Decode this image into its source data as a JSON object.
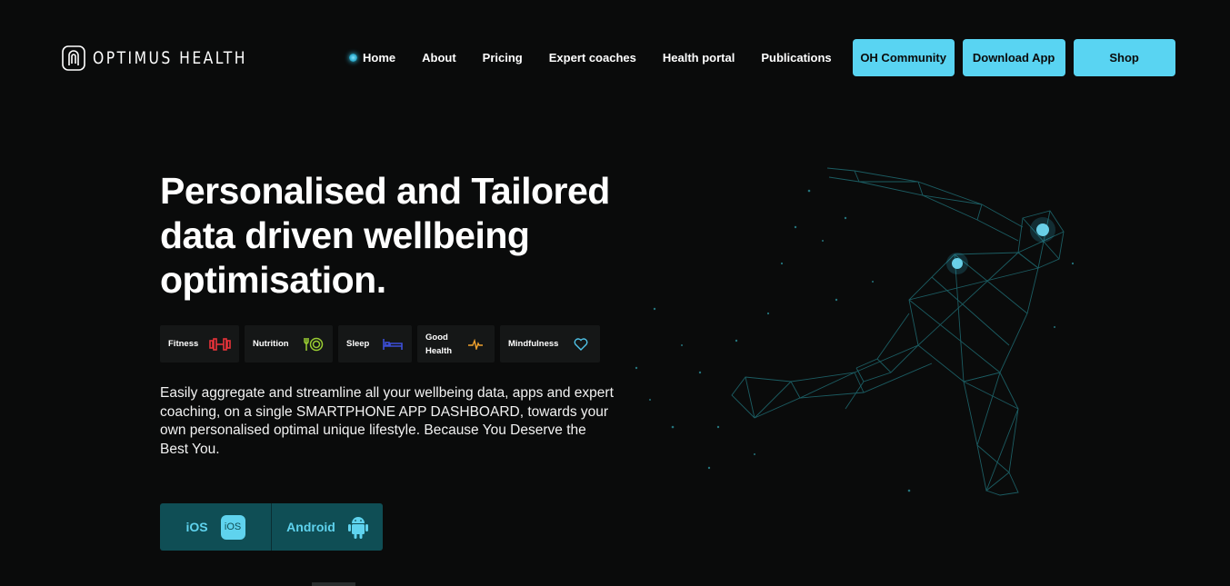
{
  "brand": {
    "name": "OPTIMUS HEALTH",
    "logo_icon": "fingerprint-icon"
  },
  "nav": {
    "links": [
      "Home",
      "About",
      "Pricing",
      "Expert coaches",
      "Health portal",
      "Publications"
    ],
    "buttons": [
      "OH Community",
      "Download App",
      "Shop"
    ],
    "accent": "#59d4f2"
  },
  "hero": {
    "title": "Personalised and Tailored data driven wellbeing optimisation.",
    "categories": [
      {
        "label": "Fitness",
        "icon": "dumbbell-icon",
        "color": "#e8333a"
      },
      {
        "label": "Nutrition",
        "icon": "plate-cutlery-icon",
        "color": "#9acd32"
      },
      {
        "label": "Sleep",
        "icon": "bed-icon",
        "color": "#3d4fd9"
      },
      {
        "label": "Good Health",
        "icon": "heartbeat-icon",
        "color": "#f0a22e"
      },
      {
        "label": "Mindfulness",
        "icon": "heart-icon",
        "color": "#4fc3e8"
      }
    ],
    "description": "Easily aggregate and streamline all your wellbeing data, apps and expert coaching, on a single SMARTPHONE APP DASHBOARD, towards your own personalised optimal unique lifestyle. Because You Deserve the Best You.",
    "store": {
      "ios_label": "iOS",
      "ios_badge": "iOS",
      "android_label": "Android"
    }
  }
}
